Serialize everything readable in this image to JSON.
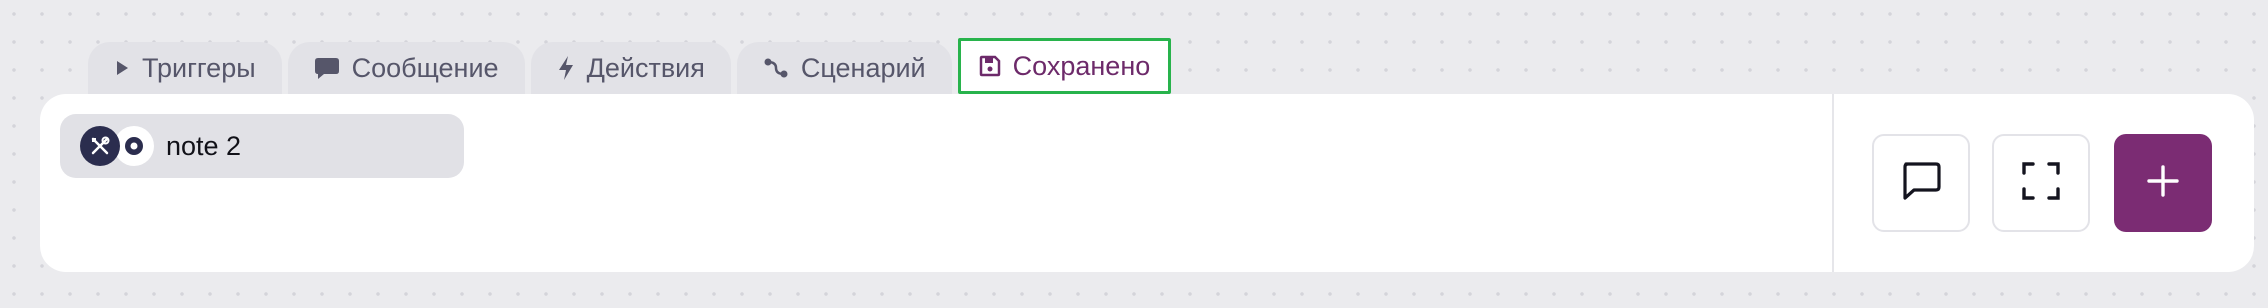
{
  "tabs": [
    {
      "label": "Триггеры",
      "icon": "play-icon",
      "active": false
    },
    {
      "label": "Сообщение",
      "icon": "chat-bubble-icon",
      "active": false
    },
    {
      "label": "Действия",
      "icon": "lightning-icon",
      "active": false
    },
    {
      "label": "Сценарий",
      "icon": "flow-icon",
      "active": false
    },
    {
      "label": "Сохранено",
      "icon": "save-icon",
      "active": true
    }
  ],
  "chip": {
    "label": "note 2",
    "icons": [
      "tools-icon",
      "record-icon"
    ]
  },
  "actions": {
    "icons": [
      "comment-icon",
      "fullscreen-icon",
      "plus-icon"
    ]
  },
  "colors": {
    "accent": "#7b2c73",
    "active_tab_border": "#28b34c",
    "active_tab_text": "#6d2a6a"
  }
}
